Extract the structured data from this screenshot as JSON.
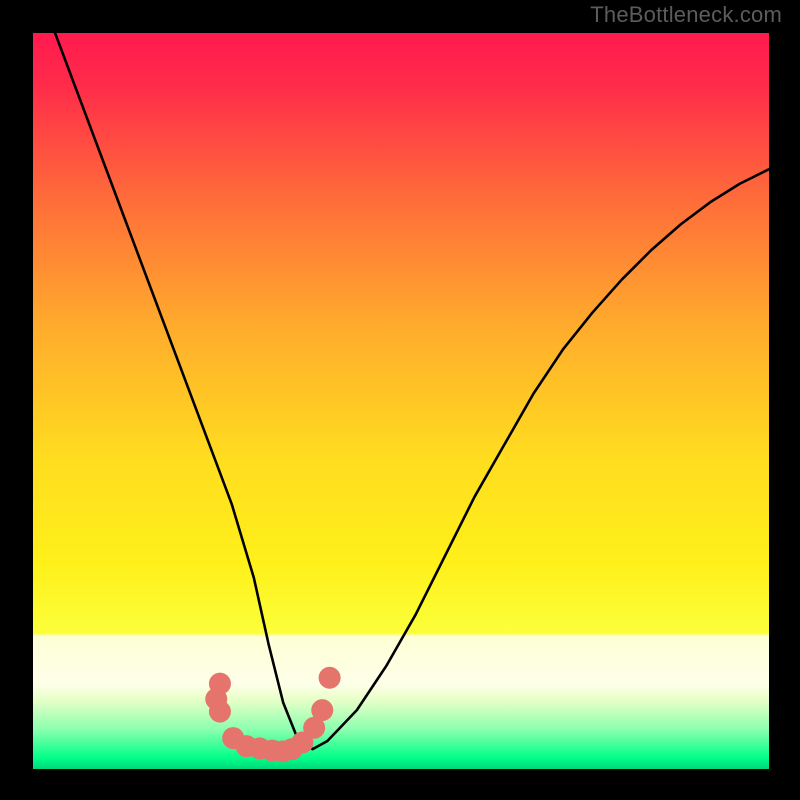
{
  "watermark": "TheBottleneck.com",
  "chart_data": {
    "type": "line",
    "title": "",
    "xlabel": "",
    "ylabel": "",
    "x_range": [
      0,
      100
    ],
    "y_range": [
      0,
      100
    ],
    "x": [
      0,
      3,
      6,
      9,
      12,
      15,
      18,
      21,
      24,
      27,
      30,
      32,
      34,
      36,
      38,
      40,
      44,
      48,
      52,
      56,
      60,
      64,
      68,
      72,
      76,
      80,
      84,
      88,
      92,
      96,
      100
    ],
    "y": [
      108,
      100,
      92,
      84,
      76,
      68,
      60,
      52,
      44,
      36,
      26,
      17,
      9,
      4,
      2.7,
      3.8,
      8,
      14,
      21,
      29,
      37,
      44,
      51,
      57,
      62,
      66.5,
      70.5,
      74,
      77,
      79.5,
      81.5
    ],
    "markers": {
      "x": [
        25.4,
        24.9,
        25.4,
        27.2,
        29.0,
        30.8,
        32.5,
        34.0,
        35.2,
        36.6,
        38.2,
        39.3,
        40.3
      ],
      "y": [
        11.6,
        9.5,
        7.8,
        4.2,
        3.1,
        2.8,
        2.5,
        2.4,
        2.7,
        3.6,
        5.6,
        8.0,
        12.4
      ]
    },
    "background_gradient": {
      "top": "#ff1a4e",
      "mid": "#ffe000",
      "band_top": "#fdffd5",
      "band_bottom": "#00ff88"
    }
  }
}
